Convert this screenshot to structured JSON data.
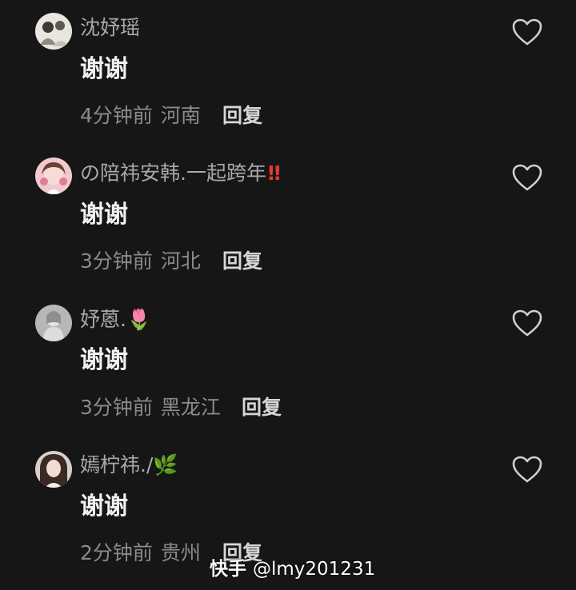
{
  "comments": [
    {
      "username": "沈妤瑶",
      "content": "谢谢",
      "time": "4分钟前",
      "region": "河南",
      "reply_label": "回复",
      "liked": false
    },
    {
      "username": "の陪祎安韩.一起跨年",
      "username_emoji": "‼",
      "content": "谢谢",
      "time": "3分钟前",
      "region": "河北",
      "reply_label": "回复",
      "liked": false
    },
    {
      "username": "妤蒽.",
      "username_emoji": "🌷",
      "content": "谢谢",
      "time": "3分钟前",
      "region": "黑龙江",
      "reply_label": "回复",
      "liked": false
    },
    {
      "username": "嫣柠祎./",
      "username_emoji": "🌿",
      "content": "谢谢",
      "time": "2分钟前",
      "region": "贵州",
      "reply_label": "回复",
      "liked": false
    }
  ],
  "watermark": {
    "brand": "快手",
    "handle": "@lmy201231"
  },
  "colors": {
    "background": "#161616",
    "username": "#a9a9a9",
    "content": "#f2f2f2",
    "meta": "#8a8a8a",
    "reply": "#d6d6d6",
    "heart_outline": "#cfcfcf",
    "alert_red": "#e53935"
  },
  "icons": {
    "like": "heart-outline-icon"
  }
}
